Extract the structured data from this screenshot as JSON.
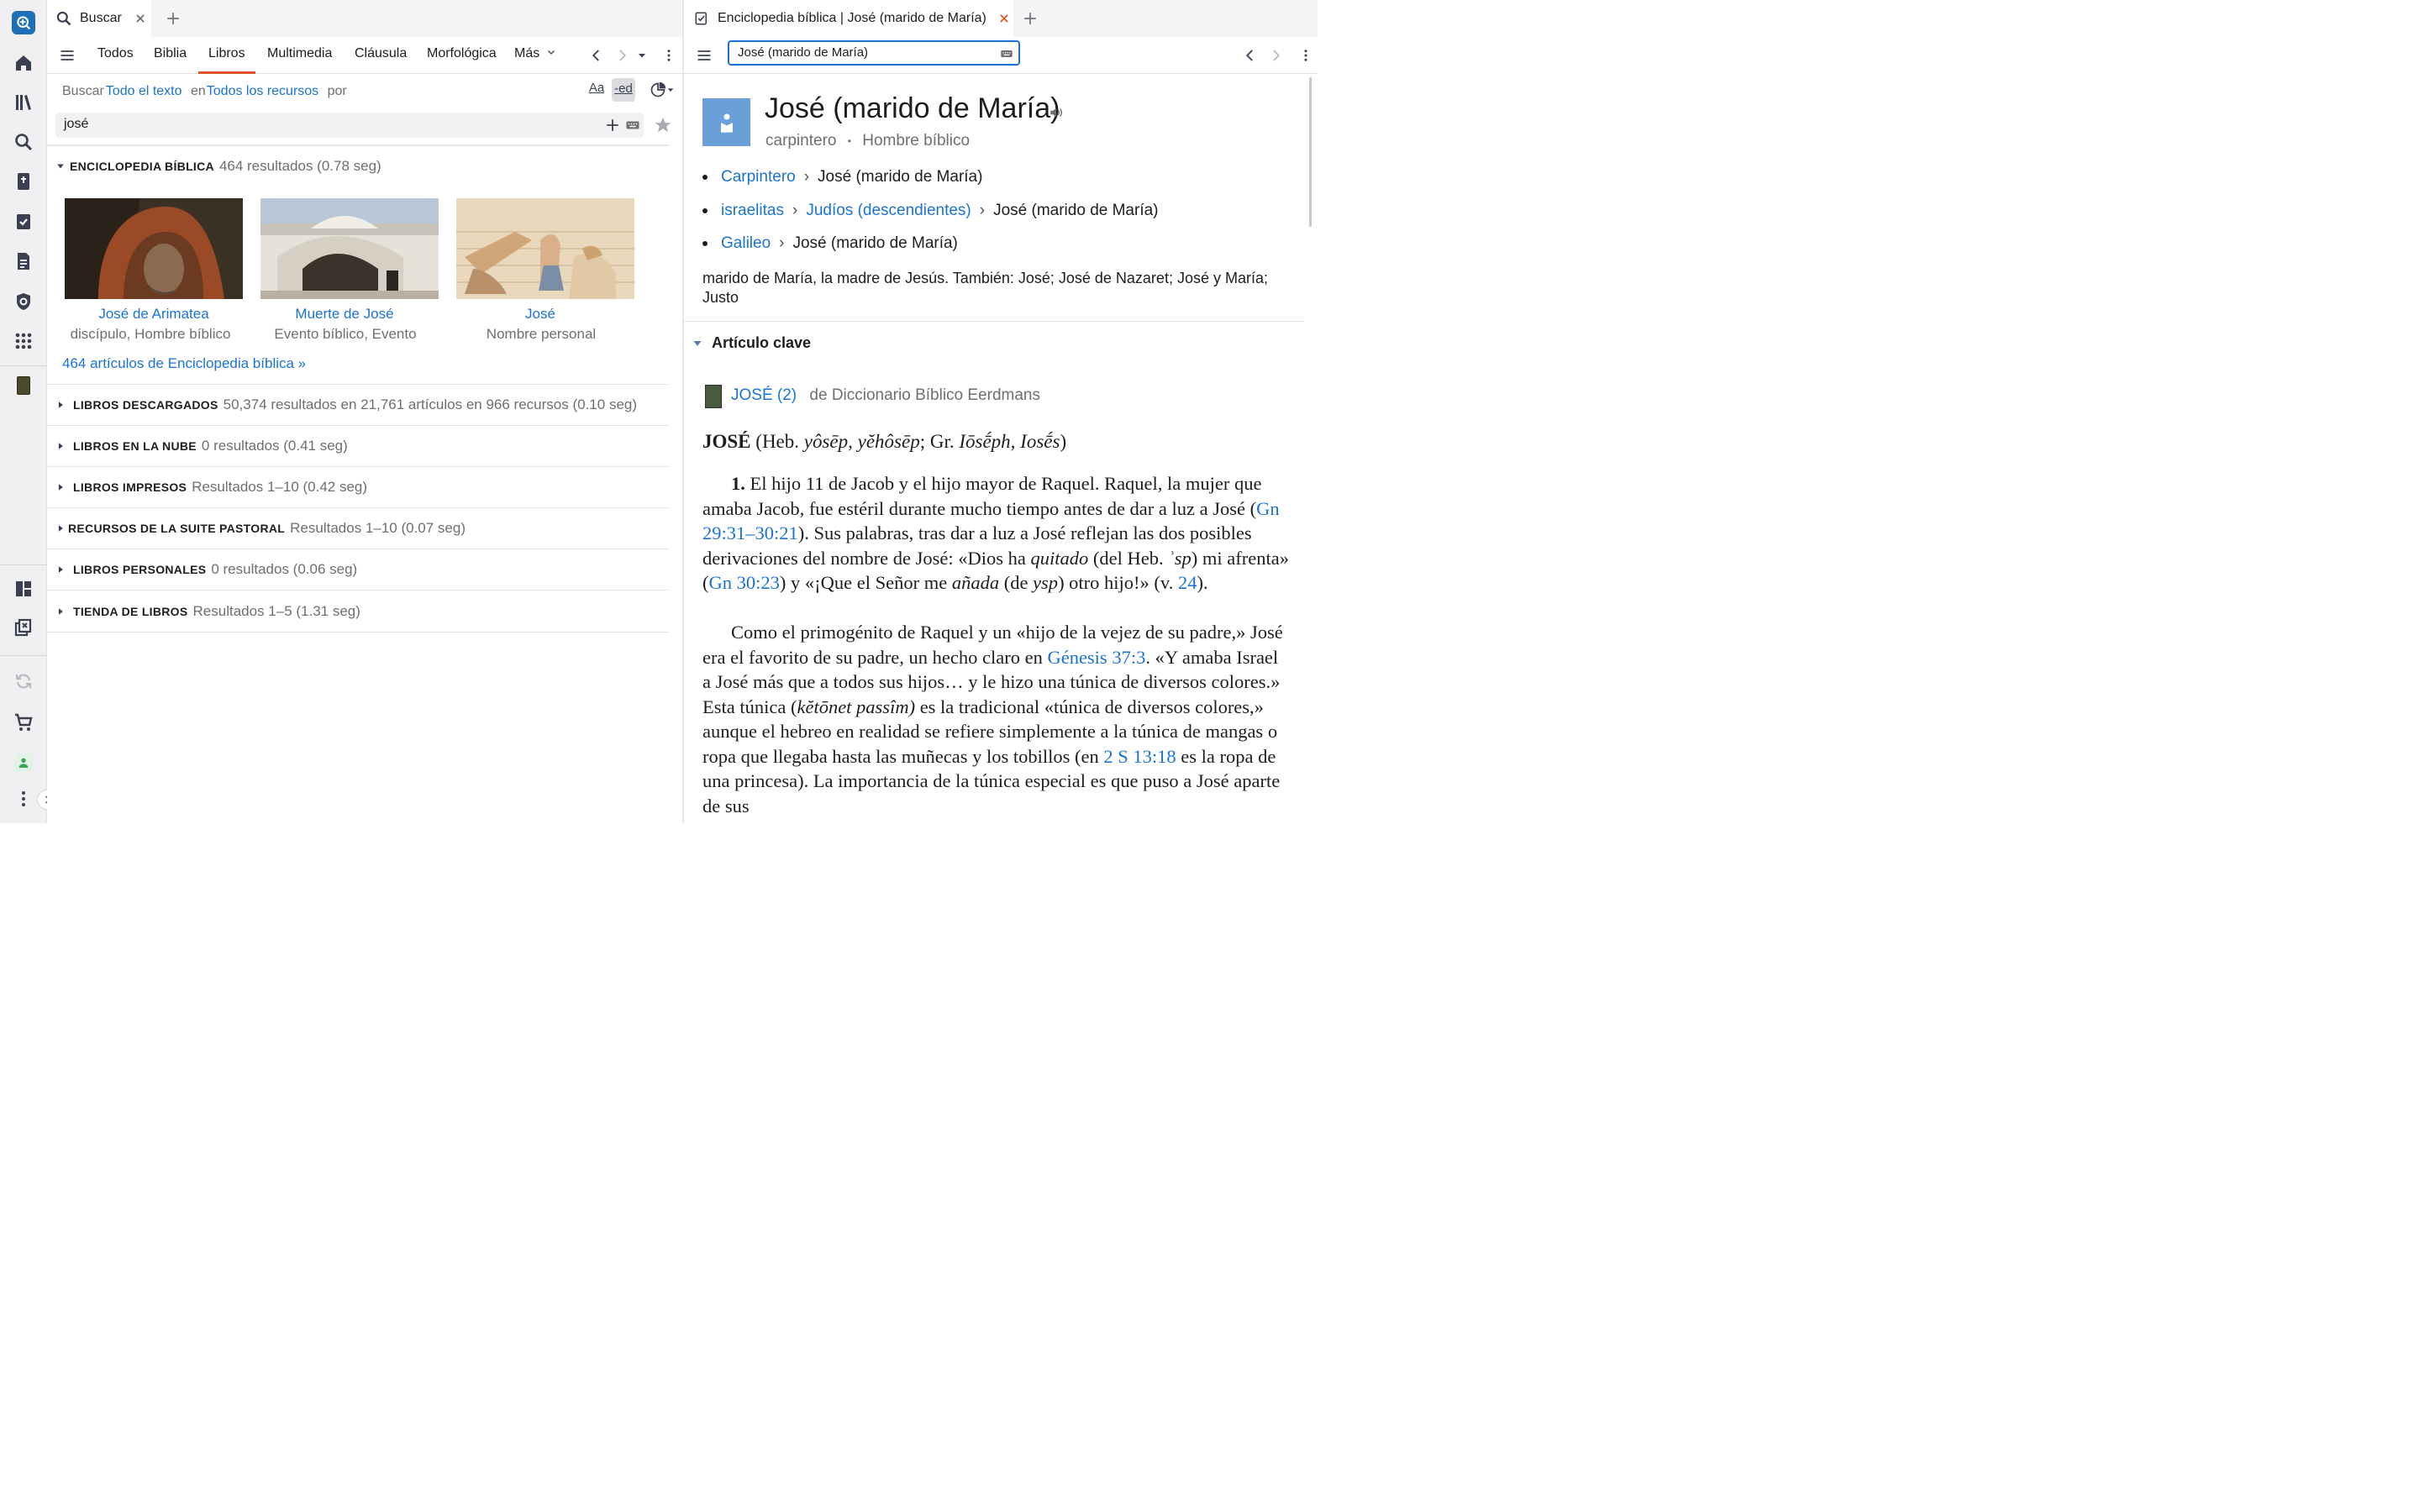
{
  "left_pane": {
    "tab": {
      "label": "Buscar"
    },
    "nav_tabs": [
      "Todos",
      "Biblia",
      "Libros",
      "Multimedia",
      "Cláusula",
      "Morfológica",
      "Más"
    ],
    "active_tab_index": 2,
    "scope": {
      "prefix": "Buscar",
      "kind": "Todo el texto",
      "in_word": "en",
      "resources": "Todos los recursos",
      "by_word": "por"
    },
    "option_labels": {
      "case": "Aa",
      "stem": "-ed"
    },
    "search_query": "josé",
    "encyclopedia": {
      "title": "ENCICLOPEDIA BÍBLICA",
      "meta": "464 resultados (0.78 seg)",
      "cards": [
        {
          "title": "José de Arimatea",
          "subtitle": "discípulo, Hombre bíblico"
        },
        {
          "title": "Muerte de José",
          "subtitle": "Evento bíblico, Evento"
        },
        {
          "title": "José",
          "subtitle": "Nombre personal"
        }
      ],
      "more_link": "464 artículos de Enciclopedia bíblica »"
    },
    "sections": [
      {
        "title": "LIBROS DESCARGADOS",
        "meta": "50,374 resultados en 21,761 artículos en 966 recursos (0.10 seg)"
      },
      {
        "title": "LIBROS EN LA NUBE",
        "meta": "0 resultados (0.41 seg)"
      },
      {
        "title": "LIBROS IMPRESOS",
        "meta": "Resultados 1–10 (0.42 seg)"
      },
      {
        "title": "RECURSOS DE LA SUITE PASTORAL",
        "meta": "Resultados 1–10 (0.07 seg)"
      },
      {
        "title": "LIBROS PERSONALES",
        "meta": "0 resultados (0.06 seg)"
      },
      {
        "title": "TIENDA DE LIBROS",
        "meta": "Resultados 1–5 (1.31 seg)"
      }
    ]
  },
  "right_pane": {
    "tab": {
      "label": "Enciclopedia bíblica | José (marido de María)"
    },
    "search_value": "José (marido de María)",
    "article": {
      "title": "José (marido de María)",
      "subtitle_1": "carpintero",
      "subtitle_2": "Hombre bíblico",
      "breadcrumbs": [
        {
          "links": [
            "Carpintero"
          ],
          "current": "José (marido de María)"
        },
        {
          "links": [
            "israelitas",
            "Judíos (descendientes)"
          ],
          "current": "José (marido de María)"
        },
        {
          "links": [
            "Galileo"
          ],
          "current": "José (marido de María)"
        }
      ],
      "description": "marido de María, la madre de Jesús. También: José; José de Nazaret; José y María; Justo",
      "key_article_heading": "Artículo clave",
      "source": {
        "link": "JOSÉ (2)",
        "from": "de Diccionario Bíblico Eerdmans"
      },
      "entry_head": {
        "term": "JOSÉ",
        "pre": " (Heb. ",
        "heb": "yôsēp, yĕhôsēp",
        "mid": "; Gr. ",
        "gr": "Iōsḗph, Iosḗs",
        "post": ")"
      },
      "para1": {
        "num": "1.",
        "t1": " El hijo 11 de Jacob y el hijo mayor de Raquel. Raquel, la mujer que amaba Jacob, fue estéril durante mucho tiempo antes de dar a luz a José (",
        "ref1": "Gn 29:31–30:21",
        "t2": "). Sus palabras, tras dar a luz a José reflejan las dos posibles derivaciones del nombre de José: «Dios ha ",
        "i1": "quitado",
        "t3": " (del Heb. ",
        "i2": "ʾsp",
        "t4": ") mi afrenta» (",
        "ref2": "Gn 30:23",
        "t5": ") y «¡Que el Señor me ",
        "i3": "añada",
        "t6": " (de ",
        "i4": "ysp",
        "t7": ") otro hijo!» (v. ",
        "ref3": "24",
        "t8": ")."
      },
      "para2": {
        "t1": "Como el primogénito de Raquel y un «hijo de la vejez de su padre,» José era el favorito de su padre, un hecho claro en ",
        "ref1": "Génesis 37:3",
        "t2": ". «Y amaba Israel a José más que a todos sus hijos… y le hizo una túnica de diversos colores.» Esta túnica (",
        "i1": "kĕtōnet passîm)",
        "t3": " es la tradicional «túnica de diversos colores,» aunque el hebreo en realidad se refiere simplemente a la túnica de mangas o ropa que llegaba hasta las muñecas y los tobillos (en ",
        "ref2": "2 S 13:18",
        "t4": " es la ropa de una princesa). La importancia de la túnica especial es que puso a José aparte de sus"
      }
    }
  },
  "colors": {
    "accent": "#1a73d4",
    "muted": "#6e6e73",
    "app_icon": "#1e6fb6",
    "profile": "#34a853"
  }
}
